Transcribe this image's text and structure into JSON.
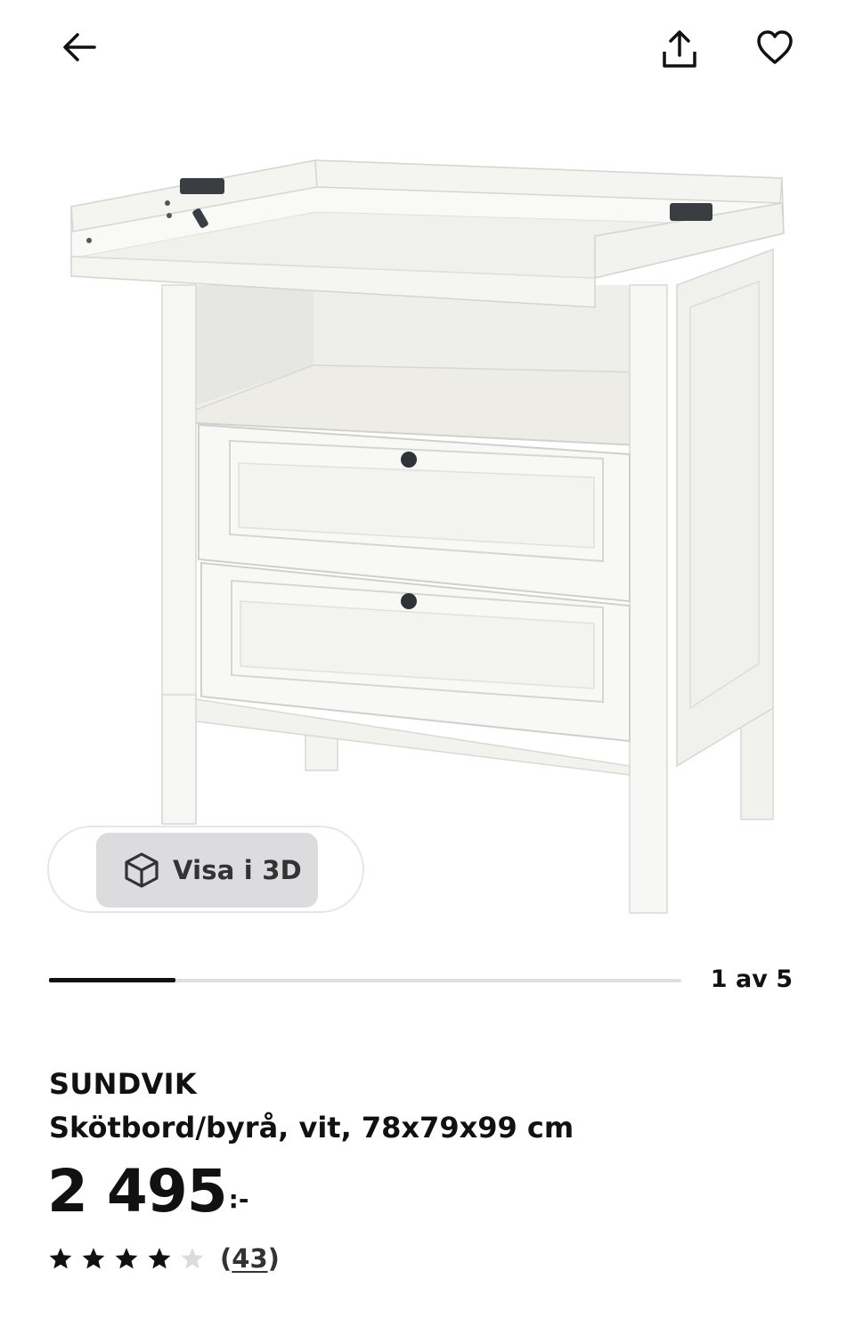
{
  "header": {
    "back_icon": "arrow-left-icon",
    "share_icon": "share-icon",
    "favorite_icon": "heart-outline-icon"
  },
  "gallery": {
    "view_3d_label": "Visa i 3D",
    "view_3d_icon": "cube-icon",
    "current_image": 1,
    "total_images": 5,
    "counter_text": "1 av 5",
    "progress_fraction": 0.2
  },
  "product": {
    "name": "SUNDVIK",
    "description": "Skötbord/byrå, vit, 78x79x99 cm",
    "price": "2 495",
    "price_suffix": ":-",
    "rating": 4,
    "rating_max": 5,
    "review_count_open": "(",
    "review_count": "43",
    "review_count_close": ")"
  },
  "colors": {
    "text": "#111111",
    "star_filled": "#111111",
    "star_empty": "#dcdcdc",
    "button_bg": "#dcdcde",
    "progress_track": "#dfdfdf"
  }
}
